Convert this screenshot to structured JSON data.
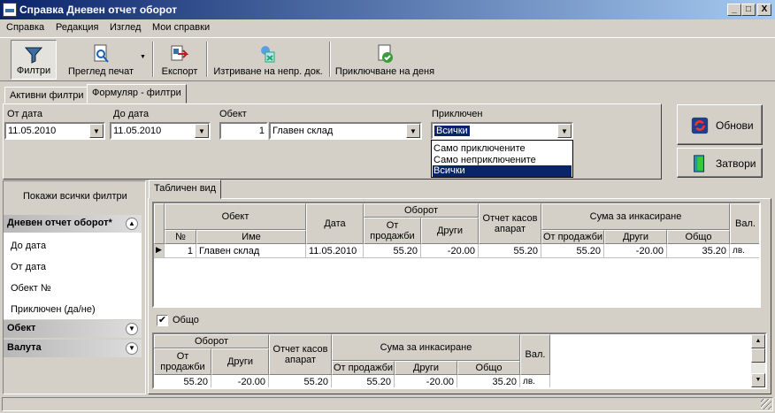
{
  "window": {
    "title": "Справка Дневен отчет оборот",
    "min": "_",
    "max": "□",
    "close": "X"
  },
  "menu": [
    "Справка",
    "Редакция",
    "Изглед",
    "Мои справки"
  ],
  "toolbar": {
    "filters": "Филтри",
    "print_preview": "Преглед печат",
    "export": "Експорт",
    "delete_unposted": "Изтриване на непр. док.",
    "close_day": "Приключване на деня"
  },
  "tabs": {
    "active_filters": "Активни филтри",
    "form_filters": "Формуляр - филтри"
  },
  "filters": {
    "from_date": {
      "label": "От дата",
      "value": "11.05.2010"
    },
    "to_date": {
      "label": "До дата",
      "value": "11.05.2010"
    },
    "object": {
      "label": "Обект",
      "number": "1",
      "name": "Главен склад"
    },
    "closed": {
      "label": "Приключен",
      "value": "Всички",
      "options": [
        "Само приключените",
        "Само неприключените",
        "Всички"
      ]
    }
  },
  "buttons": {
    "refresh": "Обнови",
    "close": "Затвори"
  },
  "sidebar": {
    "show_all": "Покажи всички филтри",
    "group_main": "Дневен отчет оборот*",
    "items": [
      "До дата",
      "От дата",
      "Обект №",
      "Приключен (да/не)"
    ],
    "group_object": "Обект",
    "group_currency": "Валута"
  },
  "table_tab": "Табличен вид",
  "table": {
    "h_object": "Обект",
    "h_date": "Дата",
    "h_turnover": "Оборот",
    "h_cash_report": "Отчет касов апарат",
    "h_collect": "Сума за инкасиране",
    "h_cur": "Вал.",
    "h_no": "№",
    "h_name": "Име",
    "h_from_sales": "От продажби",
    "h_other": "Други",
    "h_total": "Общо",
    "row": {
      "no": "1",
      "name": "Главен склад",
      "date": "11.05.2010",
      "sales": "55.20",
      "other": "-20.00",
      "cash": "55.20",
      "c_sales": "55.20",
      "c_other": "-20.00",
      "c_total": "35.20",
      "cur": "лв."
    }
  },
  "total": {
    "checkbox_label": "Общо",
    "checked": true,
    "row": {
      "sales": "55.20",
      "other": "-20.00",
      "cash": "55.20",
      "c_sales": "55.20",
      "c_other": "-20.00",
      "c_total": "35.20",
      "cur": "лв."
    }
  }
}
